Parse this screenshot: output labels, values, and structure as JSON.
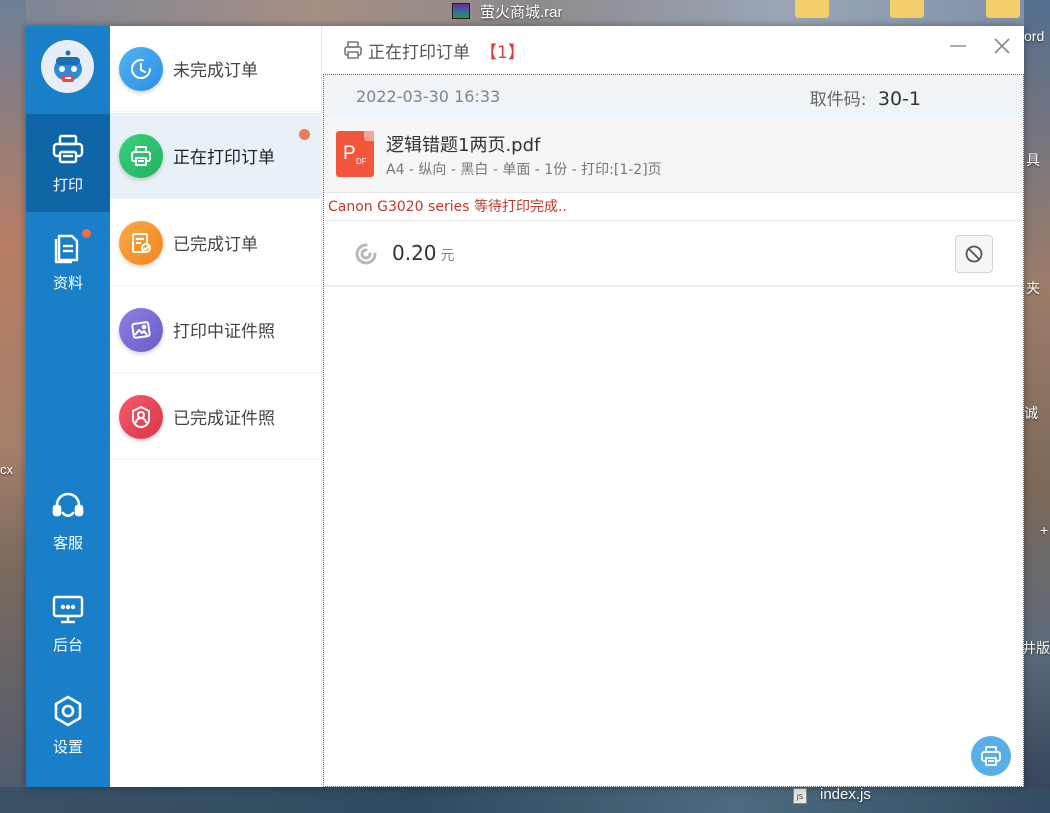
{
  "desktop": {
    "top_file": "萤火商城.rar",
    "bottom_file": "index.js",
    "right_fragments": [
      "ord",
      "具",
      "夹",
      "诚",
      "+",
      "井版"
    ],
    "left_fragment": "cx"
  },
  "nav": {
    "items": [
      {
        "label": "打印",
        "icon": "printer-icon"
      },
      {
        "label": "资料",
        "icon": "document-icon"
      },
      {
        "label": "客服",
        "icon": "headset-icon"
      },
      {
        "label": "后台",
        "icon": "monitor-icon"
      },
      {
        "label": "设置",
        "icon": "settings-icon"
      }
    ],
    "active": "打印"
  },
  "menu": {
    "items": [
      {
        "label": "未完成订单",
        "icon": "clock-icon",
        "color": "#3fa0f0"
      },
      {
        "label": "正在打印订单",
        "icon": "printer-icon",
        "color": "#2fc36c"
      },
      {
        "label": "已完成订单",
        "icon": "checklist-icon",
        "color": "#f7962e"
      },
      {
        "label": "打印中证件照",
        "icon": "photo-icon",
        "color": "#7d6fd9"
      },
      {
        "label": "已完成证件照",
        "icon": "portrait-icon",
        "color": "#f0475a"
      }
    ],
    "active": "正在打印订单"
  },
  "main": {
    "title": "正在打印订单",
    "count": "【1】",
    "order": {
      "datetime": "2022-03-30 16:33",
      "pickup_label": "取件码:",
      "pickup_code": "30-1",
      "file_name": "逻辑错题1两页.pdf",
      "file_meta": "A4 - 纵向 - 黑白 - 单面 - 1份 - 打印:[1-2]页",
      "status": "Canon G3020 series 等待打印完成..",
      "price": "0.20",
      "unit": "元"
    }
  },
  "colors": {
    "nav_bg": "#1a7fc9",
    "nav_active": "#0e66a8",
    "accent_red": "#e03a3a",
    "status_red": "#c0392b",
    "float_button": "#5aaee8"
  }
}
